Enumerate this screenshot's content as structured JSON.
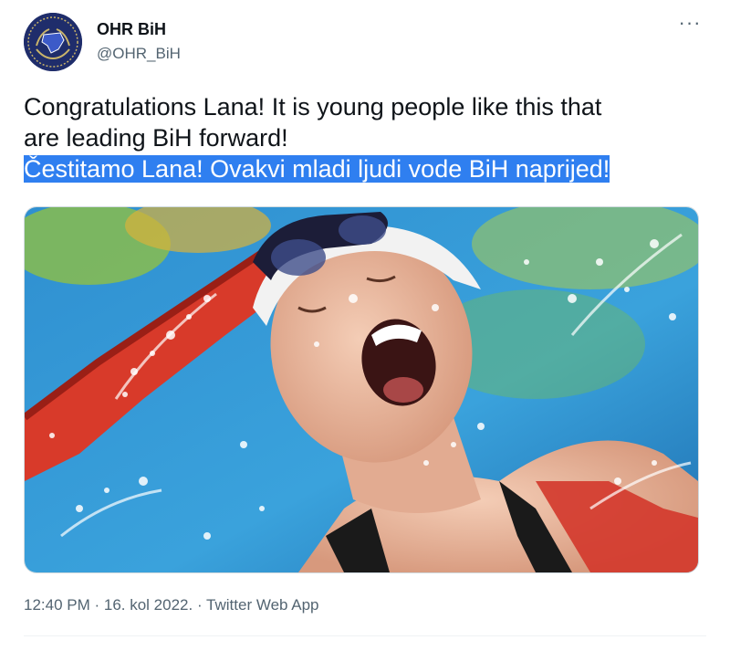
{
  "author": {
    "name": "OHR BiH",
    "handle": "@OHR_BiH",
    "avatar_bg": "#1f2d6b"
  },
  "menu": {
    "more_label": "···"
  },
  "tweet": {
    "line1": "Congratulations Lana! It is young people like this that",
    "line2": "are leading BiH forward!",
    "line3_selected": "Čestitamo Lana! Ovakvi mladi ljudi vode BiH naprijed!",
    "selection_color": "#2f7ff0"
  },
  "media": {
    "icon": "photo-swimmer-celebrating"
  },
  "meta": {
    "time": "12:40 PM",
    "sep1": " · ",
    "date": "16. kol 2022.",
    "sep2": " · ",
    "app": "Twitter Web App"
  }
}
